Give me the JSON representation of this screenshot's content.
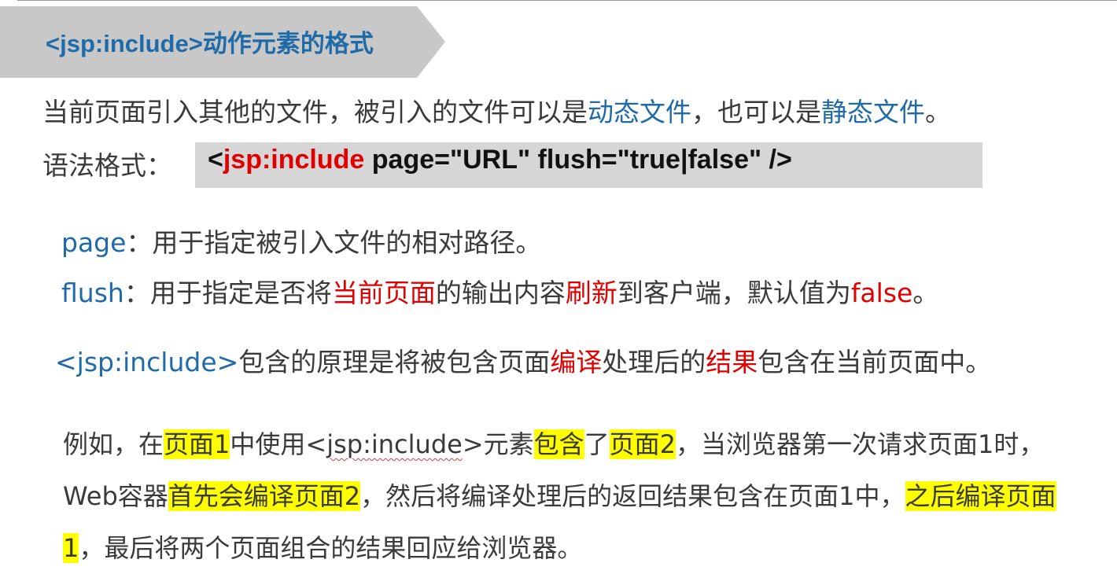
{
  "title": "<jsp:include>动作元素的格式",
  "intro": {
    "p1": "当前页面引入其他的文件，被引入的文件可以是",
    "dyn": "动态文件",
    "p2": "，也可以是",
    "stat": "静态文件",
    "p3": "。"
  },
  "syntax": {
    "label": "语法格式：",
    "lt": "<",
    "tag": "jsp:include",
    "rest": " page=\"URL\" flush=\"true|false\" />"
  },
  "attrs": {
    "page_key": "page",
    "page_desc": "：用于指定被引入文件的相对路径。",
    "flush_key": "flush",
    "flush_p1": "：用于指定是否将",
    "flush_h1": "当前页面",
    "flush_p2": "的输出内容",
    "flush_h2": "刷新",
    "flush_p3": "到客户端，默认值为",
    "flush_h3": "false",
    "flush_p4": "。"
  },
  "principle": {
    "tag": "<jsp:include>",
    "p1": "包含的原理是将被包含页面",
    "h1": "编译",
    "p2": "处理后的",
    "h2": "结果",
    "p3": "包含在当前页面中。"
  },
  "example": {
    "s1": "例如，在",
    "hl1": "页面1",
    "s2": "中使用<",
    "tag": "jsp:include",
    "s3": ">元素",
    "hl2": "包含",
    "s4": "了",
    "hl3": "页面2",
    "s5": "，当浏览器第一次请求页面1时，Web容器",
    "hl4": "首先会编译页面2",
    "s6": "，然后将编译处理后的返回结果包含在页面1中，",
    "hl5": "之后编译页面1",
    "s7": "，最后将两个页面组合的结果回应给浏览器。"
  },
  "colors": {
    "accent_blue": "#1f6aa8",
    "emphasis_red": "#e00000",
    "highlight_yellow": "#ffff00",
    "banner_gray": "#c8c8c8",
    "code_bg": "#d6d6d6"
  }
}
